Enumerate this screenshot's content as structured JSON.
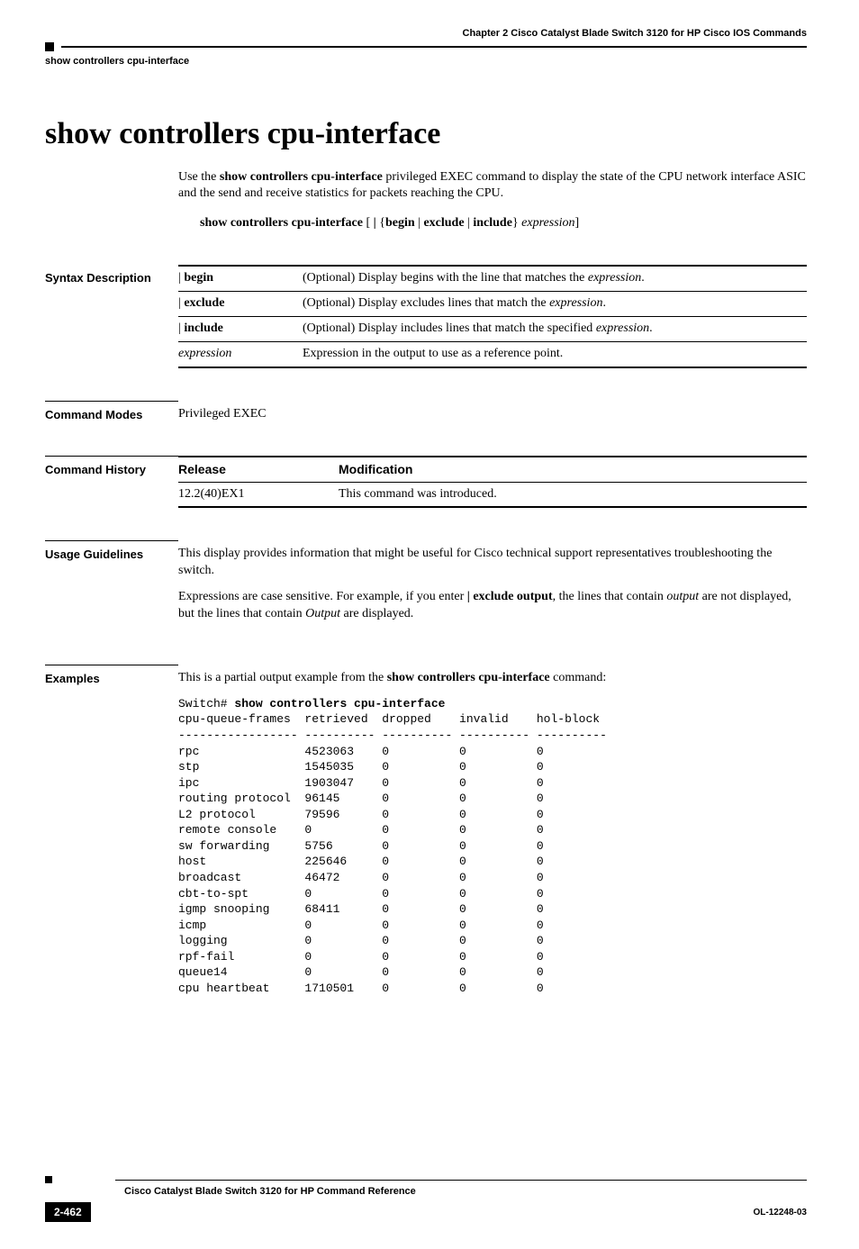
{
  "header": {
    "chapter": "Chapter 2      Cisco Catalyst Blade Switch 3120 for HP Cisco IOS Commands",
    "sub": "show controllers cpu-interface"
  },
  "title": "show controllers cpu-interface",
  "intro": {
    "p1a": "Use the ",
    "p1b": "show controllers cpu-interface",
    "p1c": " privileged EXEC command to display the state of the CPU network interface ASIC and the send and receive statistics for packets reaching the CPU."
  },
  "syntax_line": {
    "cmd": "show controllers cpu-interface",
    "sep1": " [ ",
    "pipe": "|",
    "sep2": " {",
    "o1": "begin",
    "s1": " | ",
    "o2": "exclude",
    "s2": " | ",
    "o3": "include",
    "sep3": "} ",
    "expr": "expression",
    "sep4": "]"
  },
  "sections": {
    "syntax": "Syntax Description",
    "modes": "Command Modes",
    "history": "Command History",
    "usage": "Usage Guidelines",
    "examples": "Examples"
  },
  "syntax_rows": [
    {
      "opt_pre": "| ",
      "opt": "begin",
      "desc_a": "(Optional) Display begins with the line that matches the ",
      "desc_i": "expression",
      "desc_b": "."
    },
    {
      "opt_pre": "| ",
      "opt": "exclude",
      "desc_a": "(Optional) Display excludes lines that match the ",
      "desc_i": "expression",
      "desc_b": "."
    },
    {
      "opt_pre": "| ",
      "opt": "include",
      "desc_a": "(Optional) Display includes lines that match the specified ",
      "desc_i": "expression",
      "desc_b": "."
    },
    {
      "opt_pre": "",
      "opt": "expression",
      "italic": true,
      "desc_a": "Expression in the output to use as a reference point.",
      "desc_i": "",
      "desc_b": ""
    }
  ],
  "modes_text": "Privileged EXEC",
  "history_head": {
    "release": "Release",
    "mod": "Modification"
  },
  "history_row": {
    "release": "12.2(40)EX1",
    "mod": "This command was introduced."
  },
  "usage": {
    "p1": "This display provides information that might be useful for Cisco technical support representatives troubleshooting the switch.",
    "p2a": "Expressions are case sensitive. For example, if you enter ",
    "p2b": "| exclude output",
    "p2c": ", the lines that contain ",
    "p2d": "output",
    "p2e": " are not displayed, but the lines that contain ",
    "p2f": "Output",
    "p2g": " are displayed."
  },
  "examples": {
    "intro_a": "This is a partial output example from the ",
    "intro_b": "show controllers cpu-interface",
    "intro_c": " command:",
    "prompt": "Switch# ",
    "cmd": "show controllers cpu-interface",
    "out": "cpu-queue-frames  retrieved  dropped    invalid    hol-block\n----------------- ---------- ---------- ---------- ----------\nrpc               4523063    0          0          0\nstp               1545035    0          0          0\nipc               1903047    0          0          0\nrouting protocol  96145      0          0          0\nL2 protocol       79596      0          0          0\nremote console    0          0          0          0\nsw forwarding     5756       0          0          0\nhost              225646     0          0          0\nbroadcast         46472      0          0          0\ncbt-to-spt        0          0          0          0\nigmp snooping     68411      0          0          0\nicmp              0          0          0          0\nlogging           0          0          0          0\nrpf-fail          0          0          0          0\nqueue14           0          0          0          0\ncpu heartbeat     1710501    0          0          0"
  },
  "footer": {
    "title": "Cisco Catalyst Blade Switch 3120 for HP Command Reference",
    "page": "2-462",
    "docid": "OL-12248-03"
  }
}
